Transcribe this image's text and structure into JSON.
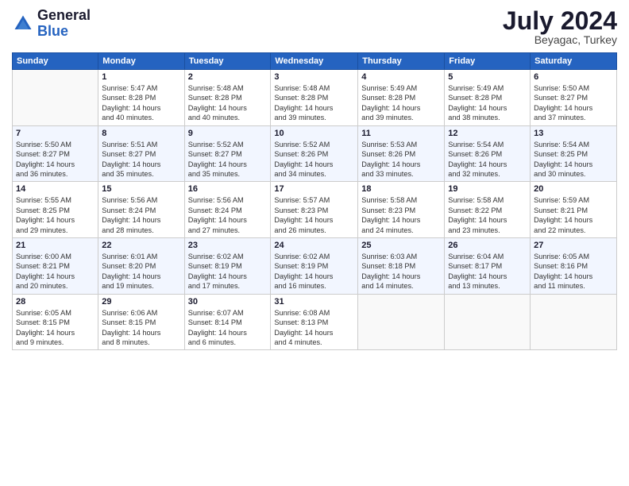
{
  "logo": {
    "general": "General",
    "blue": "Blue"
  },
  "title": "July 2024",
  "location": "Beyagac, Turkey",
  "days_header": [
    "Sunday",
    "Monday",
    "Tuesday",
    "Wednesday",
    "Thursday",
    "Friday",
    "Saturday"
  ],
  "weeks": [
    [
      {
        "num": "",
        "info": ""
      },
      {
        "num": "1",
        "info": "Sunrise: 5:47 AM\nSunset: 8:28 PM\nDaylight: 14 hours\nand 40 minutes."
      },
      {
        "num": "2",
        "info": "Sunrise: 5:48 AM\nSunset: 8:28 PM\nDaylight: 14 hours\nand 40 minutes."
      },
      {
        "num": "3",
        "info": "Sunrise: 5:48 AM\nSunset: 8:28 PM\nDaylight: 14 hours\nand 39 minutes."
      },
      {
        "num": "4",
        "info": "Sunrise: 5:49 AM\nSunset: 8:28 PM\nDaylight: 14 hours\nand 39 minutes."
      },
      {
        "num": "5",
        "info": "Sunrise: 5:49 AM\nSunset: 8:28 PM\nDaylight: 14 hours\nand 38 minutes."
      },
      {
        "num": "6",
        "info": "Sunrise: 5:50 AM\nSunset: 8:27 PM\nDaylight: 14 hours\nand 37 minutes."
      }
    ],
    [
      {
        "num": "7",
        "info": "Sunrise: 5:50 AM\nSunset: 8:27 PM\nDaylight: 14 hours\nand 36 minutes."
      },
      {
        "num": "8",
        "info": "Sunrise: 5:51 AM\nSunset: 8:27 PM\nDaylight: 14 hours\nand 35 minutes."
      },
      {
        "num": "9",
        "info": "Sunrise: 5:52 AM\nSunset: 8:27 PM\nDaylight: 14 hours\nand 35 minutes."
      },
      {
        "num": "10",
        "info": "Sunrise: 5:52 AM\nSunset: 8:26 PM\nDaylight: 14 hours\nand 34 minutes."
      },
      {
        "num": "11",
        "info": "Sunrise: 5:53 AM\nSunset: 8:26 PM\nDaylight: 14 hours\nand 33 minutes."
      },
      {
        "num": "12",
        "info": "Sunrise: 5:54 AM\nSunset: 8:26 PM\nDaylight: 14 hours\nand 32 minutes."
      },
      {
        "num": "13",
        "info": "Sunrise: 5:54 AM\nSunset: 8:25 PM\nDaylight: 14 hours\nand 30 minutes."
      }
    ],
    [
      {
        "num": "14",
        "info": "Sunrise: 5:55 AM\nSunset: 8:25 PM\nDaylight: 14 hours\nand 29 minutes."
      },
      {
        "num": "15",
        "info": "Sunrise: 5:56 AM\nSunset: 8:24 PM\nDaylight: 14 hours\nand 28 minutes."
      },
      {
        "num": "16",
        "info": "Sunrise: 5:56 AM\nSunset: 8:24 PM\nDaylight: 14 hours\nand 27 minutes."
      },
      {
        "num": "17",
        "info": "Sunrise: 5:57 AM\nSunset: 8:23 PM\nDaylight: 14 hours\nand 26 minutes."
      },
      {
        "num": "18",
        "info": "Sunrise: 5:58 AM\nSunset: 8:23 PM\nDaylight: 14 hours\nand 24 minutes."
      },
      {
        "num": "19",
        "info": "Sunrise: 5:58 AM\nSunset: 8:22 PM\nDaylight: 14 hours\nand 23 minutes."
      },
      {
        "num": "20",
        "info": "Sunrise: 5:59 AM\nSunset: 8:21 PM\nDaylight: 14 hours\nand 22 minutes."
      }
    ],
    [
      {
        "num": "21",
        "info": "Sunrise: 6:00 AM\nSunset: 8:21 PM\nDaylight: 14 hours\nand 20 minutes."
      },
      {
        "num": "22",
        "info": "Sunrise: 6:01 AM\nSunset: 8:20 PM\nDaylight: 14 hours\nand 19 minutes."
      },
      {
        "num": "23",
        "info": "Sunrise: 6:02 AM\nSunset: 8:19 PM\nDaylight: 14 hours\nand 17 minutes."
      },
      {
        "num": "24",
        "info": "Sunrise: 6:02 AM\nSunset: 8:19 PM\nDaylight: 14 hours\nand 16 minutes."
      },
      {
        "num": "25",
        "info": "Sunrise: 6:03 AM\nSunset: 8:18 PM\nDaylight: 14 hours\nand 14 minutes."
      },
      {
        "num": "26",
        "info": "Sunrise: 6:04 AM\nSunset: 8:17 PM\nDaylight: 14 hours\nand 13 minutes."
      },
      {
        "num": "27",
        "info": "Sunrise: 6:05 AM\nSunset: 8:16 PM\nDaylight: 14 hours\nand 11 minutes."
      }
    ],
    [
      {
        "num": "28",
        "info": "Sunrise: 6:05 AM\nSunset: 8:15 PM\nDaylight: 14 hours\nand 9 minutes."
      },
      {
        "num": "29",
        "info": "Sunrise: 6:06 AM\nSunset: 8:15 PM\nDaylight: 14 hours\nand 8 minutes."
      },
      {
        "num": "30",
        "info": "Sunrise: 6:07 AM\nSunset: 8:14 PM\nDaylight: 14 hours\nand 6 minutes."
      },
      {
        "num": "31",
        "info": "Sunrise: 6:08 AM\nSunset: 8:13 PM\nDaylight: 14 hours\nand 4 minutes."
      },
      {
        "num": "",
        "info": ""
      },
      {
        "num": "",
        "info": ""
      },
      {
        "num": "",
        "info": ""
      }
    ]
  ]
}
